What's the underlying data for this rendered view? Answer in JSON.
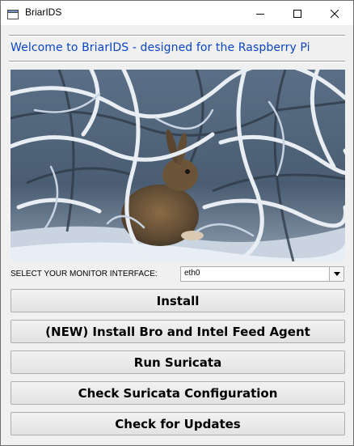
{
  "window": {
    "title": "BriarIDS",
    "controls": [
      "minimize",
      "maximize",
      "close"
    ]
  },
  "welcome_text": "Welcome to BriarIDS - designed for the Raspberry Pi",
  "image": {
    "kind": "painting of a rabbit in snowy branches"
  },
  "interface": {
    "label": "SELECT YOUR MONITOR INTERFACE:",
    "selected": "eth0"
  },
  "buttons": {
    "install": "Install",
    "install_bro": "(NEW) Install Bro and Intel Feed Agent",
    "run_suricata": "Run Suricata",
    "check_config": "Check Suricata Configuration",
    "check_updates": "Check for Updates"
  },
  "colors": {
    "welcome_text": "#0a45c8",
    "window_bg": "#f0f0f0"
  }
}
